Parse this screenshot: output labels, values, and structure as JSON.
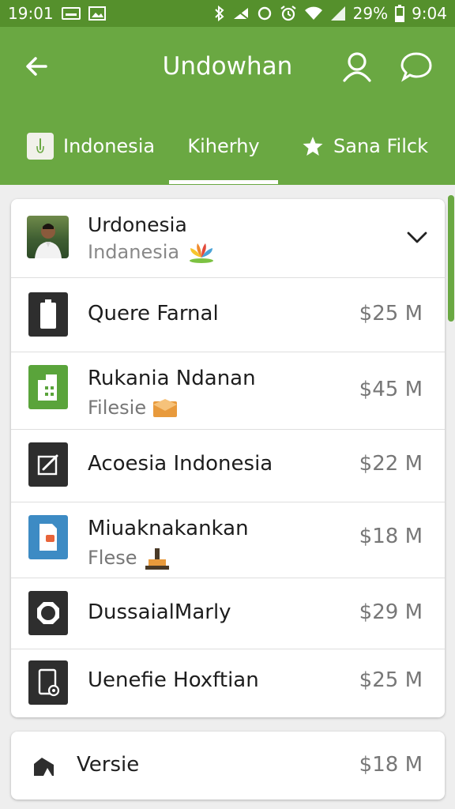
{
  "status_bar": {
    "left_time": "19:01",
    "battery": "29%",
    "time": "9:04",
    "icons": [
      "mail-icon",
      "image-icon",
      "bluetooth-icon",
      "mute-icon",
      "sync-icon",
      "alarm-icon",
      "wifi-icon",
      "signal-icon"
    ]
  },
  "app_bar": {
    "title": "Undowhan",
    "icons": [
      "back-arrow-icon",
      "search-icon",
      "chat-icon"
    ]
  },
  "tabs": [
    {
      "label": "Indonesia",
      "icon": "thermometer-icon",
      "selected": false
    },
    {
      "label": "Kiherhy",
      "icon": "",
      "selected": true
    },
    {
      "label": "Sana Filck",
      "icon": "star-icon",
      "selected": false
    }
  ],
  "header_row": {
    "title": "Urdonesia",
    "subtitle": "Indanesia",
    "icons": [
      "avatar",
      "lotus-icon",
      "chevron-down-icon"
    ]
  },
  "items": [
    {
      "name": "Quere Farnal",
      "subtitle": "",
      "price": "$25 M",
      "icon": "battery-icon",
      "thumb_color": "#2e2e2e"
    },
    {
      "name": "Rukania Ndanan",
      "subtitle": "Filesie",
      "sub_icon": "envelope-icon",
      "price": "$45 M",
      "icon": "building-icon",
      "thumb_color": "#5aa43b"
    },
    {
      "name": "Acoesia Indonesia",
      "subtitle": "",
      "price": "$22 M",
      "icon": "edit-icon",
      "thumb_color": "#2e2e2e"
    },
    {
      "name": "Miuaknakankan",
      "subtitle": "Flese",
      "sub_icon": "landmark-icon",
      "price": "$18 M",
      "icon": "document-icon",
      "thumb_color": "#3d8bc4"
    },
    {
      "name": "DussaialMarly",
      "subtitle": "",
      "price": "$29 M",
      "icon": "octagon-icon",
      "thumb_color": "#2e2e2e"
    },
    {
      "name": "Uenefie Hoxftian",
      "subtitle": "",
      "price": "$25 M",
      "icon": "tablet-settings-icon",
      "thumb_color": "#2e2e2e"
    }
  ],
  "footer_row": {
    "name": "Versie",
    "price": "$18 M",
    "icon": "house-icon"
  }
}
